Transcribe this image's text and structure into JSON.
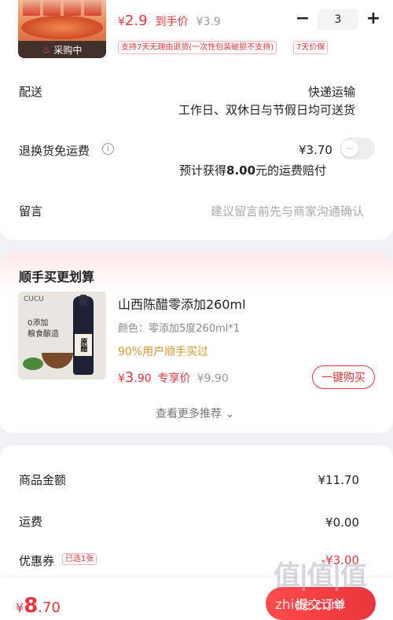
{
  "product": {
    "badge": "采购中",
    "price_currency": "¥",
    "price_value": "2.9",
    "price_tag": "到手价",
    "original_price": "¥3.9",
    "quantity": "3",
    "minus_label": "−",
    "plus_label": "+",
    "policy_return": "支持7天无理由退货(一次性包装破损不支持)",
    "policy_price": "7天价保"
  },
  "delivery": {
    "label": "配送",
    "method": "快递运输",
    "schedule": "工作日、双休日与节假日均可送货"
  },
  "return_shipping": {
    "label": "退换货免运费",
    "info_icon": "i",
    "fee": "¥3.70",
    "toggle_on": false,
    "compensation_prefix": "预计获得",
    "compensation_amount": "8.00",
    "compensation_suffix": "元的运费赔付"
  },
  "message": {
    "label": "留言",
    "placeholder": "建议留言前先与商家沟通确认"
  },
  "recommend": {
    "title": "顺手买更划算",
    "image_brand": "CUCU",
    "image_slogan_1": "0添加",
    "image_slogan_2": "粮食酿造",
    "image_label": "原醋",
    "name": "山西陈醋零添加260ml",
    "spec": "颜色：零添加5度260ml*1",
    "hint": "90%用户顺手买过",
    "price_currency": "¥",
    "price_int": "3",
    "price_dec": ".90",
    "price_tag": "专享价",
    "original_price": "¥9.90",
    "buy_button": "一键购买",
    "more_link": "查看更多推荐 ⌄"
  },
  "summary": {
    "goods_label": "商品金额",
    "goods_value": "¥11.70",
    "shipping_label": "运费",
    "shipping_value": "¥0.00",
    "coupon_label": "优惠券",
    "coupon_tag": "已选1张",
    "coupon_value": "-¥3.00"
  },
  "footer": {
    "total_currency": "¥",
    "total_int": "8",
    "total_dec": ".70",
    "submit_label": "提交订单"
  },
  "watermark": {
    "text": "值|值|值",
    "url": "zhide.com"
  },
  "colors": {
    "accent": "#e8353b",
    "hint": "#d89a2b",
    "background": "#f2f2f4"
  }
}
